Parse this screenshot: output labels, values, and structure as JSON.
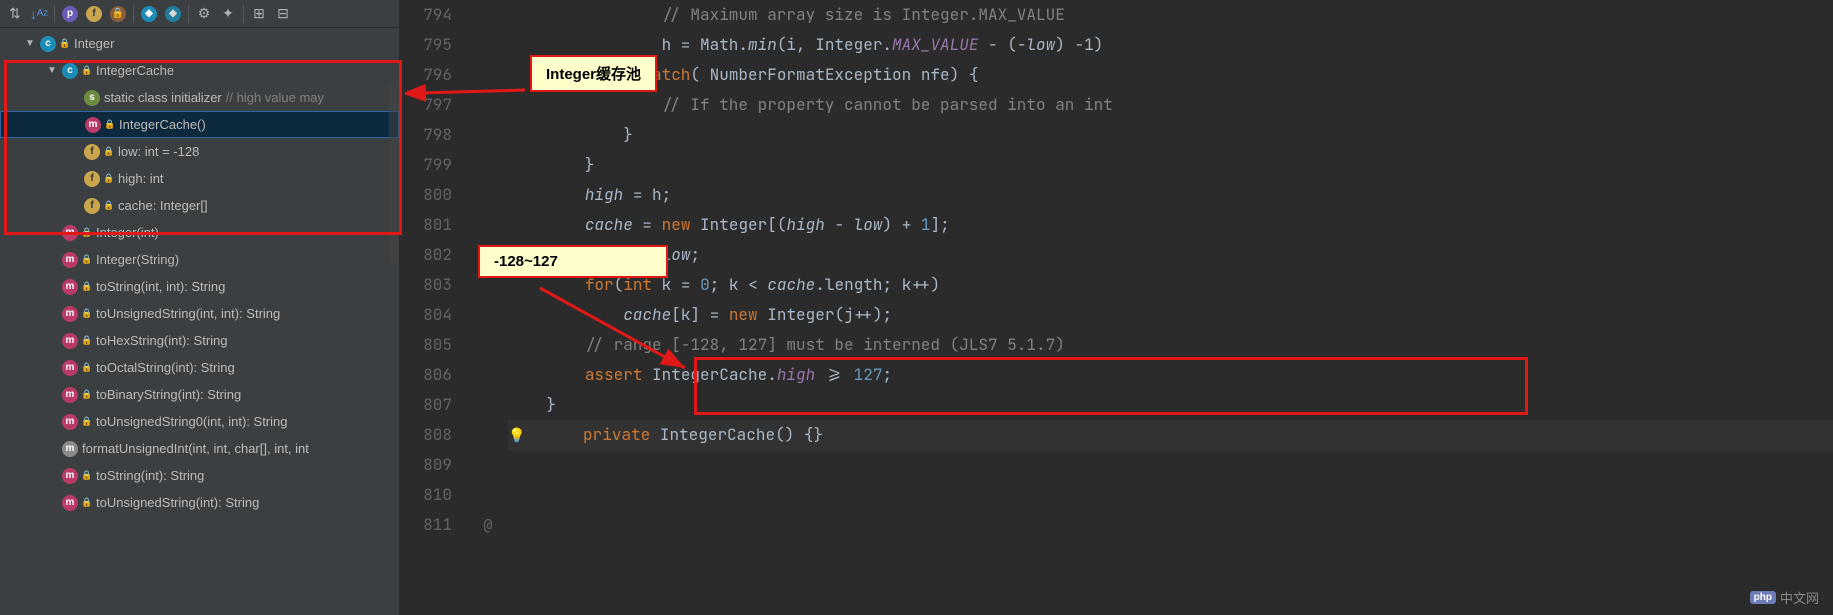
{
  "toolbar": {
    "icons": [
      "sort",
      "sort-az",
      "sep",
      "p",
      "f",
      "lock",
      "sep",
      "diamond",
      "diamond2",
      "sep",
      "gear",
      "star",
      "sep",
      "expand",
      "collapse"
    ]
  },
  "tree": {
    "root": "Integer",
    "items": [
      {
        "indent": 0,
        "caret": "▼",
        "icon": "ic-class",
        "iconText": "c",
        "lock": true,
        "label": "Integer",
        "suffix": ""
      },
      {
        "indent": 1,
        "caret": "▼",
        "icon": "ic-class",
        "iconText": "c",
        "lock": true,
        "label": "IntegerCache",
        "suffix": ""
      },
      {
        "indent": 2,
        "caret": "",
        "icon": "ic-init",
        "iconText": "s",
        "lock": false,
        "label": "static class initializer",
        "suffix": "  // high value may"
      },
      {
        "indent": 2,
        "caret": "",
        "icon": "ic-method",
        "iconText": "m",
        "lock": true,
        "label": "IntegerCache()",
        "suffix": "",
        "selected": true
      },
      {
        "indent": 2,
        "caret": "",
        "icon": "ic-field",
        "iconText": "f",
        "lock": true,
        "label": "low: int = -128",
        "suffix": ""
      },
      {
        "indent": 2,
        "caret": "",
        "icon": "ic-field",
        "iconText": "f",
        "lock": true,
        "label": "high: int",
        "suffix": ""
      },
      {
        "indent": 2,
        "caret": "",
        "icon": "ic-field",
        "iconText": "f",
        "lock": true,
        "label": "cache: Integer[]",
        "suffix": ""
      },
      {
        "indent": 1,
        "caret": "",
        "icon": "ic-method",
        "iconText": "m",
        "lock": true,
        "label": "Integer(int)",
        "suffix": ""
      },
      {
        "indent": 1,
        "caret": "",
        "icon": "ic-method",
        "iconText": "m",
        "lock": true,
        "label": "Integer(String)",
        "suffix": ""
      },
      {
        "indent": 1,
        "caret": "",
        "icon": "ic-method",
        "iconText": "m",
        "lock": true,
        "label": "toString(int, int): String",
        "suffix": ""
      },
      {
        "indent": 1,
        "caret": "",
        "icon": "ic-method",
        "iconText": "m",
        "lock": true,
        "label": "toUnsignedString(int, int): String",
        "suffix": ""
      },
      {
        "indent": 1,
        "caret": "",
        "icon": "ic-method",
        "iconText": "m",
        "lock": true,
        "label": "toHexString(int): String",
        "suffix": ""
      },
      {
        "indent": 1,
        "caret": "",
        "icon": "ic-method",
        "iconText": "m",
        "lock": true,
        "label": "toOctalString(int): String",
        "suffix": ""
      },
      {
        "indent": 1,
        "caret": "",
        "icon": "ic-method",
        "iconText": "m",
        "lock": true,
        "label": "toBinaryString(int): String",
        "suffix": ""
      },
      {
        "indent": 1,
        "caret": "",
        "icon": "ic-method",
        "iconText": "m",
        "lock": true,
        "label": "toUnsignedString0(int, int): String",
        "suffix": ""
      },
      {
        "indent": 1,
        "caret": "",
        "icon": "ic-methodp",
        "iconText": "m",
        "lock": false,
        "label": "formatUnsignedInt(int, int, char[], int, int",
        "suffix": ""
      },
      {
        "indent": 1,
        "caret": "",
        "icon": "ic-method",
        "iconText": "m",
        "lock": true,
        "label": "toString(int): String",
        "suffix": ""
      },
      {
        "indent": 1,
        "caret": "",
        "icon": "ic-method",
        "iconText": "m",
        "lock": true,
        "label": "toUnsignedString(int): String",
        "suffix": ""
      }
    ]
  },
  "callouts": {
    "c1": "Integer缓存池",
    "c2": "-128~127"
  },
  "gutter": {
    "start": 794,
    "count": 18
  },
  "code": {
    "lines": [
      {
        "raw": "                // Maximum array size is Integer.MAX_VALUE",
        "cls": "com"
      },
      {
        "html": "                h = Math.<span class='ita'>min</span>(i, Integer.<span class='ita2'>MAX_VALUE</span> - (-<span class='ita'>low</span>) -1)"
      },
      {
        "html": "            } <span class='kw'>catch</span>( NumberFormatException nfe) {"
      },
      {
        "raw": "                // If the property cannot be parsed into an int",
        "cls": "com"
      },
      {
        "raw": "            }"
      },
      {
        "raw": "        }"
      },
      {
        "html": "        <span class='ita'>high</span> = h;"
      },
      {
        "raw": ""
      },
      {
        "html": "        <span class='ita'>cache</span> = <span class='kw'>new</span> Integer[(<span class='ita'>high</span> - <span class='ita'>low</span>) + <span class='num'>1</span>];"
      },
      {
        "html": "        <span class='kw'>int</span> j = <span class='ita'>low</span>;"
      },
      {
        "html": "        <span class='kw'>for</span>(<span class='kw'>int</span> k = <span class='num'>0</span>; k &lt; <span class='ita'>cache</span>.length; k++)"
      },
      {
        "html": "            <span class='ita'>cache</span>[k] = <span class='kw'>new</span> Integer(j++);"
      },
      {
        "raw": ""
      },
      {
        "raw": "        // range [-128, 127] must be interned (JLS7 5.1.7)",
        "cls": "com"
      },
      {
        "html": "        <span class='kw'>assert</span> IntegerCache.<span class='ita2'>high</span> &gt;= <span class='num'>127</span>;"
      },
      {
        "raw": "    }"
      },
      {
        "raw": ""
      },
      {
        "html": "    <span class='kw'>private</span> <span class='cls'>IntegerCache</span>() {}",
        "hl": true
      }
    ]
  },
  "watermark": "中文网"
}
